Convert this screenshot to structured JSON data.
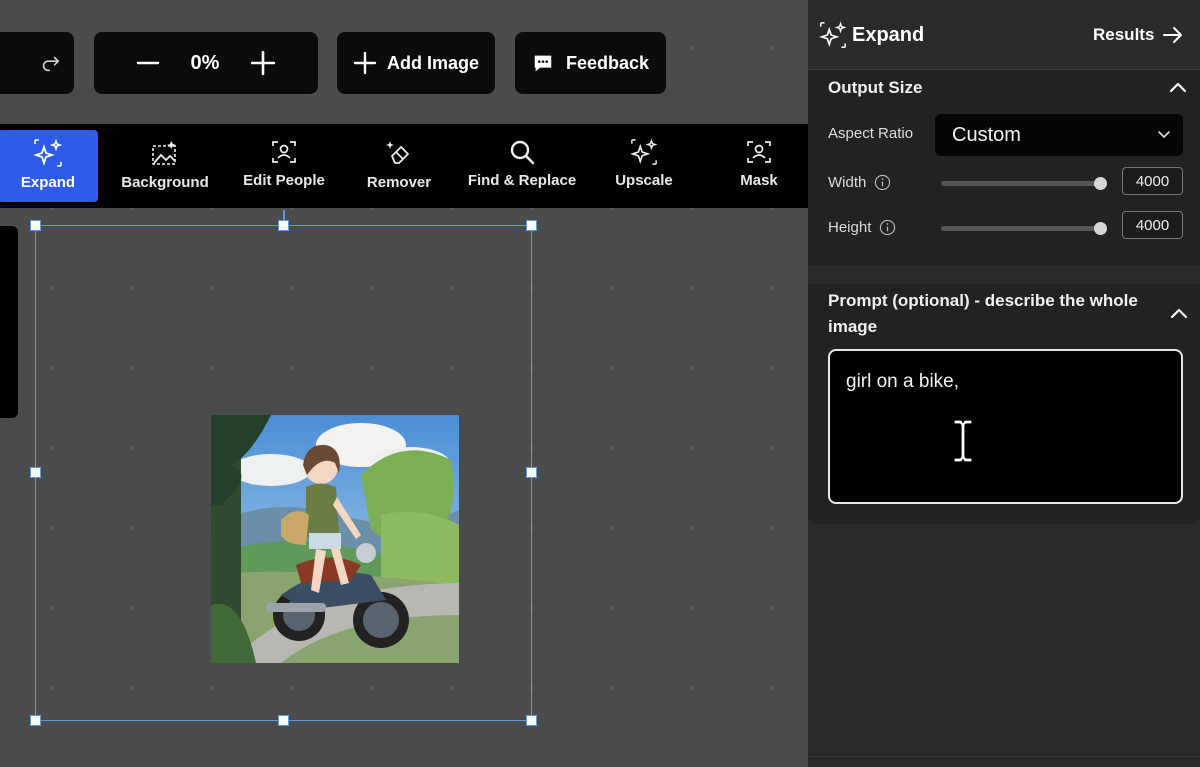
{
  "toolbar_top": {
    "zoom_minus": "—",
    "zoom_value": "0%",
    "zoom_plus": "+",
    "add_image_label": "Add Image",
    "feedback_label": "Feedback"
  },
  "tools": [
    {
      "label": "Expand",
      "icon": "sparkles-icon",
      "active": true
    },
    {
      "label": "Background",
      "icon": "image-edit-icon",
      "active": false
    },
    {
      "label": "Edit People",
      "icon": "person-scan-icon",
      "active": false
    },
    {
      "label": "Remover",
      "icon": "eraser-icon",
      "active": false
    },
    {
      "label": "Find & Replace",
      "icon": "search-icon",
      "active": false
    },
    {
      "label": "Upscale",
      "icon": "sparkles-icon",
      "active": false
    },
    {
      "label": "Mask",
      "icon": "person-scan-icon",
      "active": false
    }
  ],
  "panel": {
    "title": "Expand",
    "results_label": "Results",
    "output_size": {
      "title": "Output Size",
      "aspect_label": "Aspect Ratio",
      "aspect_value": "Custom",
      "width_label": "Width",
      "width_value": "4000",
      "height_label": "Height",
      "height_value": "4000",
      "width_level": 1.0,
      "height_level": 1.0
    },
    "prompt": {
      "title": "Prompt (optional) - describe the whole image",
      "value": "girl on a bike,"
    }
  },
  "colors": {
    "accent": "#2f5bea",
    "selection": "#5b9be0",
    "panel_bg": "#2a2a2a",
    "canvas_bg": "#4b4b4b"
  }
}
